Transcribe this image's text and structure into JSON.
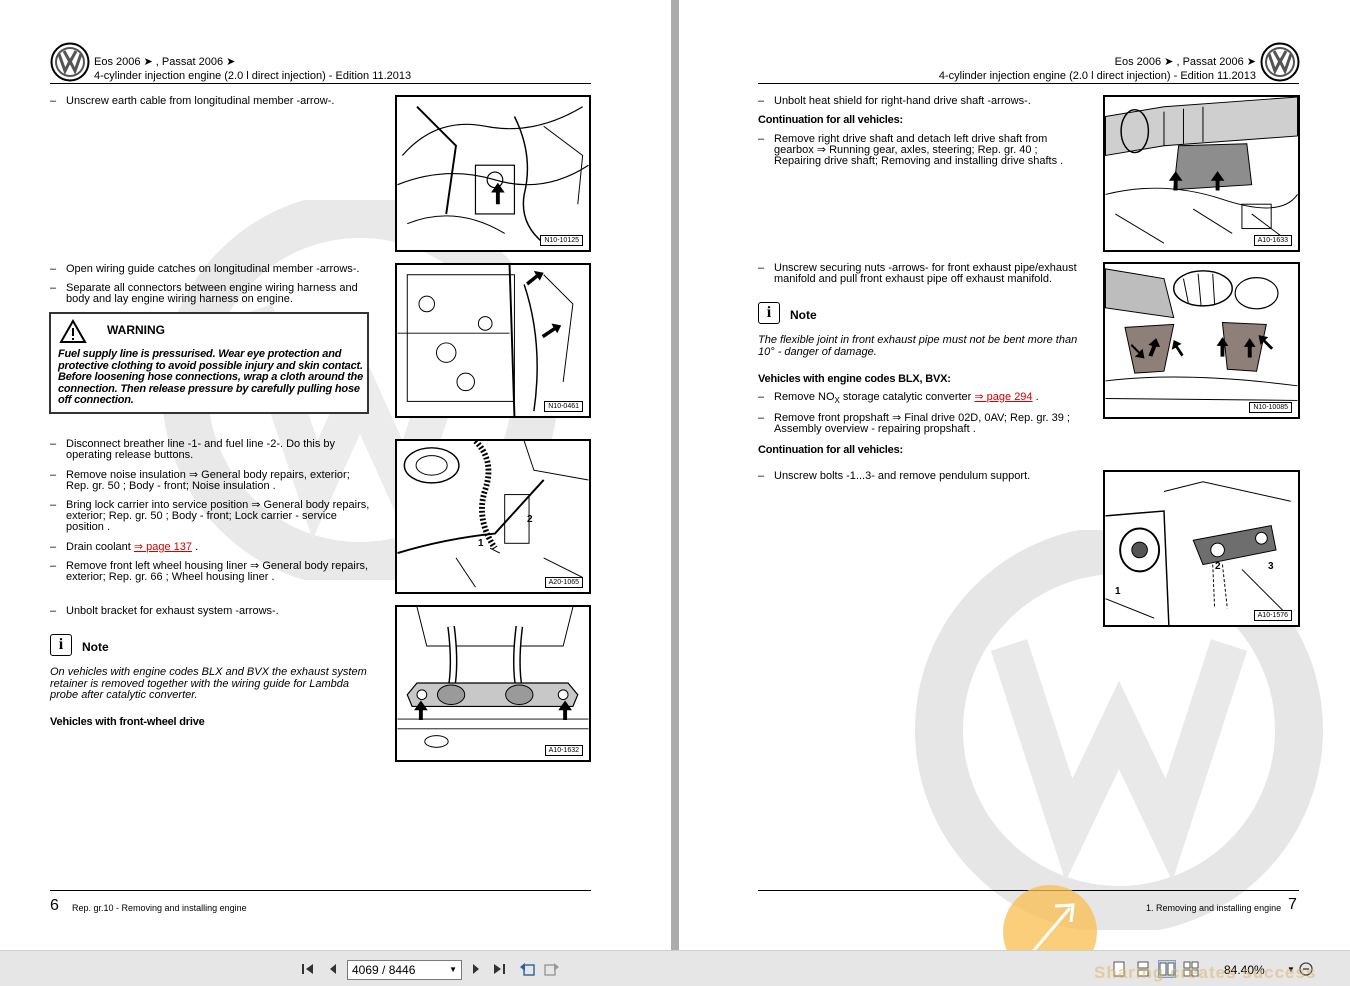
{
  "header": {
    "title_line1": "Eos 2006 ➤ , Passat 2006 ➤",
    "title_line2": "4-cylinder injection engine (2.0 l direct injection) - Edition 11.2013"
  },
  "left_page": {
    "steps_a": [
      {
        "dash": "–",
        "text": "Unscrew earth cable from longitudinal member -arrow-."
      }
    ],
    "fig1_code": "N10-10125",
    "steps_b": [
      {
        "dash": "–",
        "text": "Open wiring guide catches on longitudinal member -arrows-."
      },
      {
        "dash": "–",
        "text": "Separate all connectors between engine wiring harness and body and lay engine wiring harness on engine."
      }
    ],
    "warning": {
      "title": "WARNING",
      "text": "Fuel supply line is pressurised. Wear eye protection and protective clothing to avoid possible injury and skin contact. Before loosening hose connections, wrap a cloth around the connection. Then release pressure by carefully pulling hose off connection."
    },
    "fig2_code": "N10-0461",
    "steps_c": [
      {
        "dash": "–",
        "text": "Disconnect breather line -1- and fuel line -2-. Do this by operating release buttons."
      },
      {
        "dash": "–",
        "text": "Remove noise insulation ⇒ General body repairs, exterior; Rep. gr. 50 ; Body - front; Noise insulation ."
      },
      {
        "dash": "–",
        "text": "Bring lock carrier into service position ⇒ General body repairs, exterior; Rep. gr. 50 ; Body - front; Lock carrier - service position ."
      },
      {
        "dash": "–",
        "text_before": "Drain coolant ",
        "link": "⇒ page 137",
        "text_after": " ."
      },
      {
        "dash": "–",
        "text": "Remove front left wheel housing liner ⇒ General body repairs, exterior; Rep. gr. 66 ; Wheel housing liner ."
      }
    ],
    "fig3_code": "A20-1065",
    "fig3_labels": [
      "1",
      "2"
    ],
    "steps_d": [
      {
        "dash": "–",
        "text": "Unbolt bracket for exhaust system -arrows-."
      }
    ],
    "note": {
      "icon": "i",
      "label": "Note",
      "text": "On vehicles with engine codes BLX and BVX the exhaust system retainer is removed together with the wiring guide for Lambda probe after catalytic converter."
    },
    "heading": "Vehicles with front-wheel drive",
    "fig4_code": "A10-1632",
    "footer": {
      "page_number": "6",
      "text": "Rep. gr.10 - Removing and installing engine"
    }
  },
  "right_page": {
    "steps_a": [
      {
        "dash": "–",
        "text": "Unbolt heat shield for right-hand drive shaft -arrows-."
      }
    ],
    "heading1": "Continuation for all vehicles:",
    "steps_b": [
      {
        "dash": "–",
        "text": "Remove right drive shaft and detach left drive shaft from gearbox ⇒ Running gear, axles, steering; Rep. gr. 40 ; Repairing drive shaft; Removing and installing drive shafts ."
      }
    ],
    "fig1_code": "A10-1633",
    "steps_c": [
      {
        "dash": "–",
        "text": "Unscrew securing nuts -arrows- for front exhaust pipe/exhaust manifold and pull front exhaust pipe off exhaust manifold."
      }
    ],
    "note": {
      "icon": "i",
      "label": "Note",
      "text": "The flexible joint in front exhaust pipe must not be bent more than 10° - danger of damage."
    },
    "heading2": "Vehicles with engine codes BLX, BVX:",
    "steps_d": [
      {
        "dash": "–",
        "text_before": "Remove NO",
        "sub": "X",
        "text_mid": " storage catalytic converter ",
        "link": "⇒ page 294",
        "text_after": " ."
      },
      {
        "dash": "–",
        "text": "Remove front propshaft ⇒ Final drive 02D, 0AV; Rep. gr. 39 ; Assembly overview - repairing propshaft ."
      }
    ],
    "fig2_code": "N10-10085",
    "heading3": "Continuation for all vehicles:",
    "steps_e": [
      {
        "dash": "–",
        "text": "Unscrew bolts -1...3- and remove pendulum support."
      }
    ],
    "fig3_code": "A10-1576",
    "fig3_labels": [
      "1",
      "2",
      "3"
    ],
    "footer": {
      "page_number": "7",
      "text": "1. Removing and installing engine"
    }
  },
  "toolbar": {
    "page_field": "4069 / 8446",
    "zoom": "84.40%"
  },
  "overlay": {
    "brand_text": "Sharing creates success"
  },
  "colors": {
    "link": "#d40000",
    "toolbar_bg": "#e6e6e6",
    "viewer_bg": "#ababab"
  }
}
